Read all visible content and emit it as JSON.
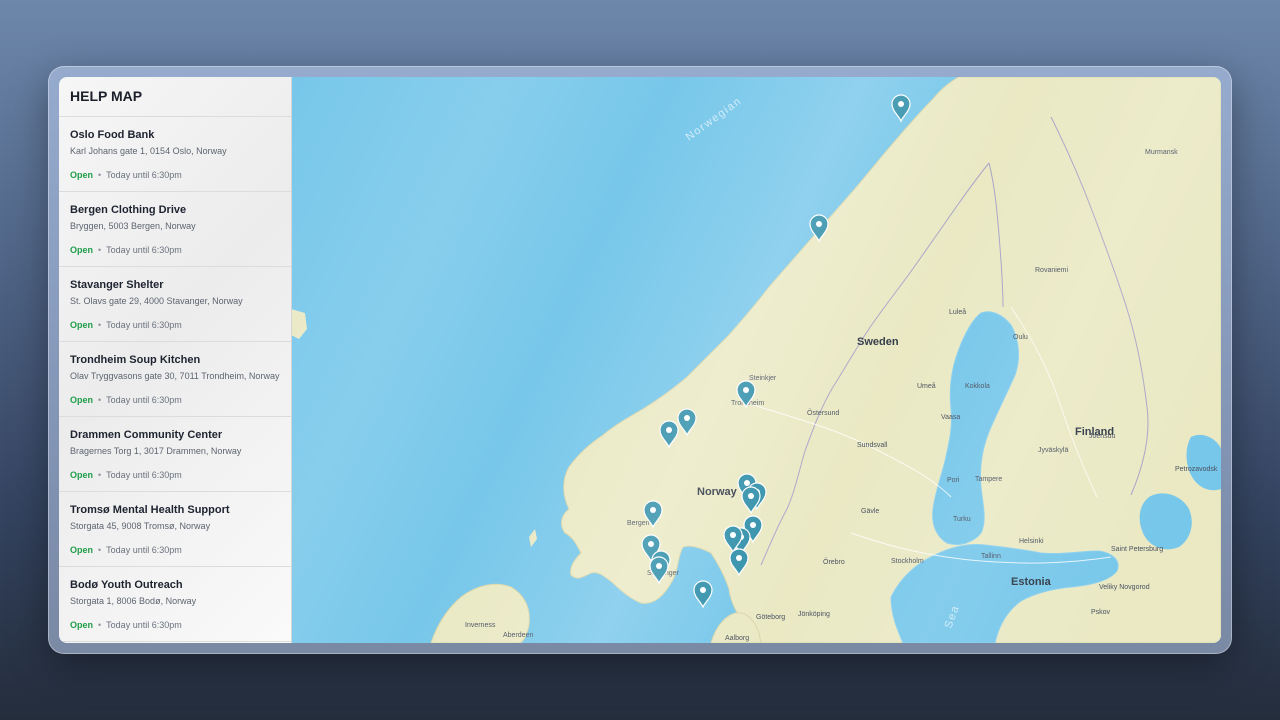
{
  "sidebar": {
    "title": "HELP MAP",
    "locations": [
      {
        "name": "Oslo Food Bank",
        "address": "Karl Johans gate 1, 0154 Oslo, Norway",
        "status": "Open",
        "hours": "Today until 6:30pm"
      },
      {
        "name": "Bergen Clothing Drive",
        "address": "Bryggen, 5003 Bergen, Norway",
        "status": "Open",
        "hours": "Today until 6:30pm"
      },
      {
        "name": "Stavanger Shelter",
        "address": "St. Olavs gate 29, 4000 Stavanger, Norway",
        "status": "Open",
        "hours": "Today until 6:30pm"
      },
      {
        "name": "Trondheim Soup Kitchen",
        "address": "Olav Tryggvasons gate 30, 7011 Trondheim, Norway",
        "status": "Open",
        "hours": "Today until 6:30pm"
      },
      {
        "name": "Drammen Community Center",
        "address": "Bragernes Torg 1, 3017 Drammen, Norway",
        "status": "Open",
        "hours": "Today until 6:30pm"
      },
      {
        "name": "Tromsø Mental Health Support",
        "address": "Storgata 45, 9008 Tromsø, Norway",
        "status": "Open",
        "hours": "Today until 6:30pm"
      },
      {
        "name": "Bodø Youth Outreach",
        "address": "Storgata 1, 8006 Bodø, Norway",
        "status": "Open",
        "hours": "Today until 6:30pm"
      }
    ]
  },
  "map": {
    "countries": [
      "Sweden",
      "Norway",
      "Finland",
      "Estonia"
    ],
    "seas": [
      "Norwegian",
      "Sea"
    ],
    "cities": [
      "Murmansk",
      "Rovaniemi",
      "Luleå",
      "Oulu",
      "Steinkjer",
      "Trondheim",
      "Östersund",
      "Umeå",
      "Kokkola",
      "Vaasa",
      "Sundsvall",
      "Joensuu",
      "Jyväskylä",
      "Petrozavodsk",
      "Pori",
      "Tampere",
      "Gävle",
      "Turku",
      "Bergen",
      "Helsinki",
      "Tallinn",
      "Saint Petersburg",
      "Stavanger",
      "Örebro",
      "Stockholm",
      "Veliky Novgorod",
      "Göteborg",
      "Jönköping",
      "Inverness",
      "Aberdeen",
      "Aalborg",
      "Pskov"
    ],
    "pin_color": "#2f8fa9",
    "water_color": "#77c7ea",
    "land_color": "#eae9c4"
  }
}
